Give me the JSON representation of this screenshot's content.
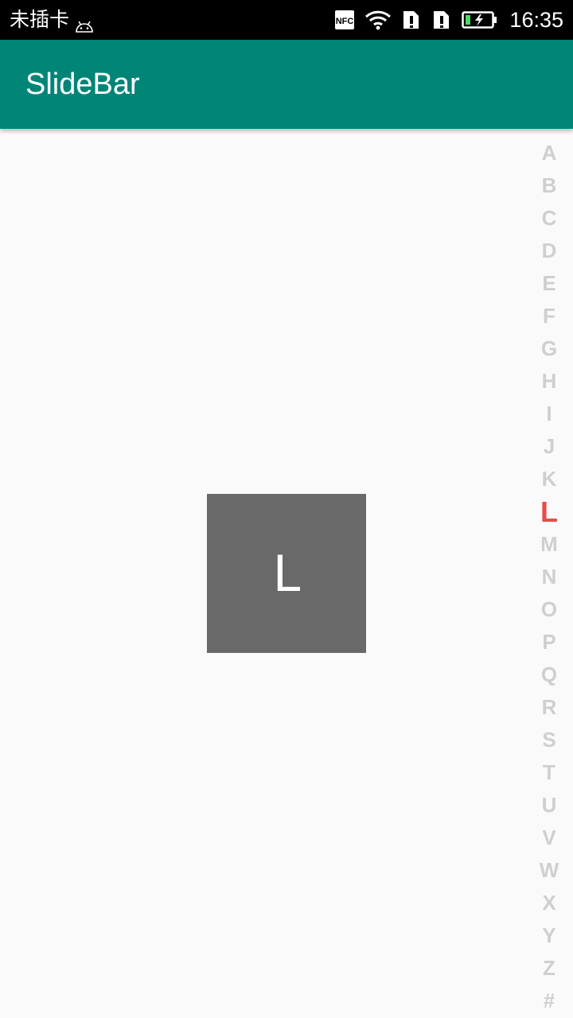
{
  "status_bar": {
    "carrier": "未插卡",
    "time": "16:35",
    "icons": [
      "android-icon",
      "nfc-icon",
      "wifi-icon",
      "sim-alert-icon",
      "sim-alert-icon",
      "battery-charging-icon"
    ]
  },
  "app_bar": {
    "title": "SlideBar",
    "color": "#008577"
  },
  "overlay": {
    "letter": "L"
  },
  "slidebar": {
    "letters": [
      "A",
      "B",
      "C",
      "D",
      "E",
      "F",
      "G",
      "H",
      "I",
      "J",
      "K",
      "L",
      "M",
      "N",
      "O",
      "P",
      "Q",
      "R",
      "S",
      "T",
      "U",
      "V",
      "W",
      "X",
      "Y",
      "Z",
      "#"
    ],
    "selected": "L",
    "normal_color": "#cfcfcf",
    "selected_color": "#e74c4c"
  }
}
